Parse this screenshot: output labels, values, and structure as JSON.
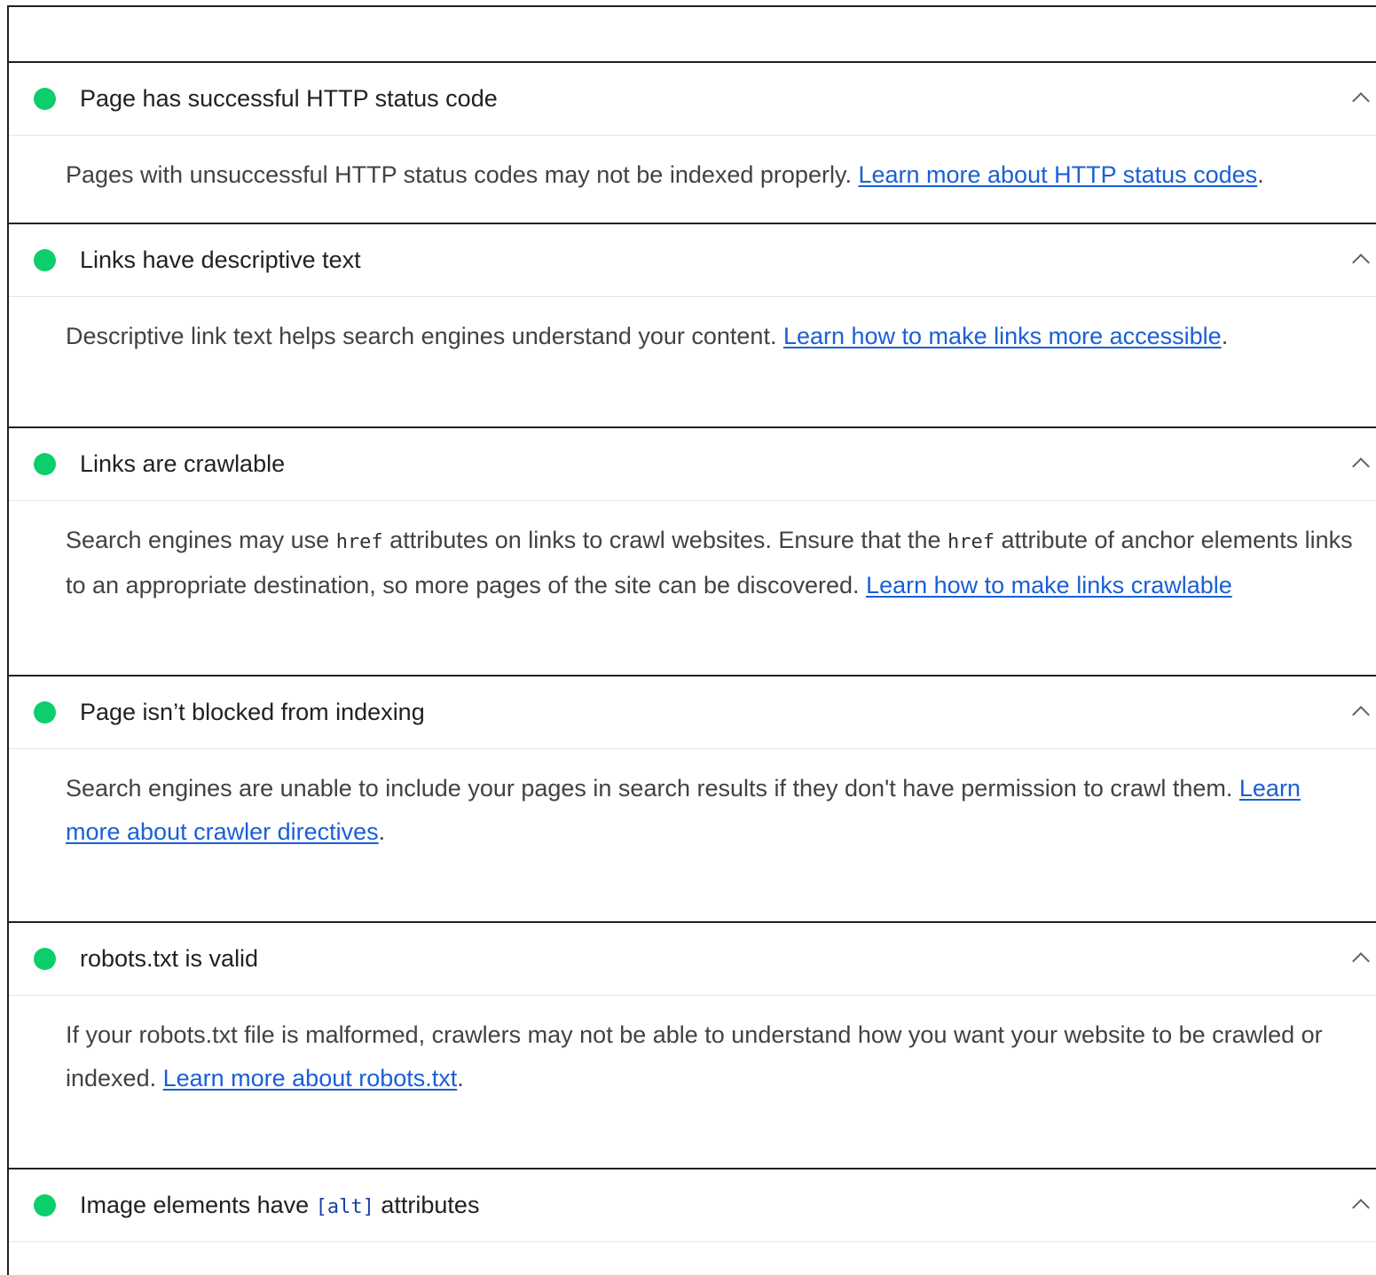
{
  "colors": {
    "pass": "#0cce6b",
    "link": "#1a5fd6",
    "border": "#202124"
  },
  "audits": [
    {
      "title": "Page has successful HTTP status code",
      "description_before": "Pages with unsuccessful HTTP status codes may not be indexed properly. ",
      "link_text": "Learn more about HTTP status codes",
      "description_after": "."
    },
    {
      "title": "Links have descriptive text",
      "description_before": "Descriptive link text helps search engines understand your content. ",
      "link_text": "Learn how to make links more accessible",
      "description_after": "."
    },
    {
      "title": "Links are crawlable",
      "desc_part1": "Search engines may use ",
      "code1": "href",
      "desc_part2": " attributes on links to crawl websites. Ensure that the ",
      "code2": "href",
      "desc_part3": " attribute of anchor elements links to an appropriate destination, so more pages of the site can be discovered. ",
      "link_text": "Learn how to make links crawlable"
    },
    {
      "title": "Page isn’t blocked from indexing",
      "description_before": "Search engines are unable to include your pages in search results if they don't have permission to crawl them. ",
      "link_text": "Learn more about crawler directives",
      "description_after": "."
    },
    {
      "title": "robots.txt is valid",
      "description_before": "If your robots.txt file is malformed, crawlers may not be able to understand how you want your website to be crawled or indexed. ",
      "link_text": "Learn more about robots.txt",
      "description_after": "."
    },
    {
      "title_before": "Image elements have ",
      "title_code": "[alt]",
      "title_after": " attributes"
    }
  ]
}
